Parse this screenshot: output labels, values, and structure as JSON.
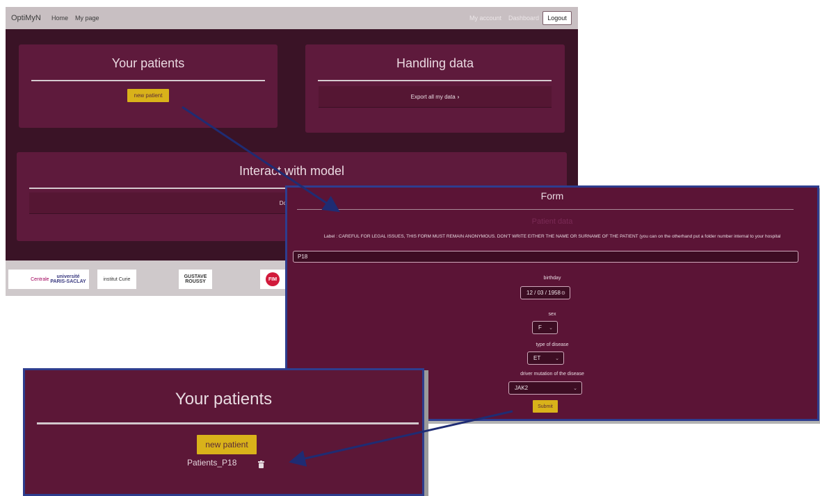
{
  "navbar": {
    "brand": "OptiMyN",
    "links": [
      "Home",
      "My page"
    ],
    "right_links": [
      "My account",
      "Dashboard"
    ],
    "logout_label": "Logout"
  },
  "patients_card": {
    "title": "Your patients",
    "new_patient_label": "new patient"
  },
  "data_card": {
    "title": "Handling data",
    "export_label": "Export all my data"
  },
  "model_card": {
    "title": "Interact with model",
    "download_label": "Donwload"
  },
  "footer": {
    "logos": [
      "CentraleSupélec",
      "université PARIS-SACLAY",
      "institut Curie",
      "GUSTAVE ROUSSY",
      "FIM"
    ]
  },
  "form": {
    "title": "Form",
    "section_title": "Patient data",
    "label_notice": "Label : CAREFUL FOR LEGAL ISSUES, THIS FORM MUST REMAIN ANONYMOUS. DON'T WRITE EITHER THE NAME OR SURNAME OF THE PATIENT (you can on the otherhand put a folder number internal to your hospital",
    "label_value": "P18",
    "birthday_label": "birthday",
    "birthday_value": "12 / 03 / 1958",
    "sex_label": "sex",
    "sex_value": "F",
    "disease_label": "type of disease",
    "disease_value": "ET",
    "mutation_label": "driver mutation of the disease",
    "mutation_value": "JAK2",
    "submit_label": "Submit"
  },
  "zoom": {
    "title": "Your patients",
    "new_patient_label": "new patient",
    "patient_entry": "Patients_P18"
  },
  "colors": {
    "card": "#5e1a3c",
    "page_bg": "#3a1326",
    "navbar": "#c8bfc2",
    "button": "#d9b21a",
    "highlight_border": "#2e3d8e",
    "arrow": "#1f2c73"
  },
  "icons": [
    "chevron-right-icon",
    "calendar-icon",
    "chevron-down-icon",
    "trash-icon",
    "arrow-icon"
  ]
}
